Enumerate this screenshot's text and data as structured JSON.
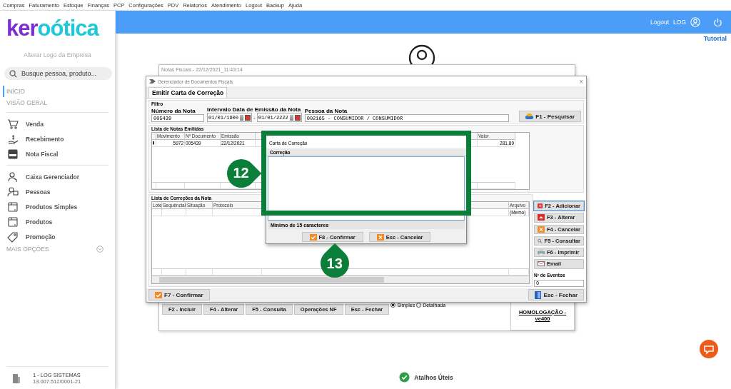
{
  "menu": [
    "Compras",
    "Faturamento",
    "Estoque",
    "Finanças",
    "PCP",
    "Configurações",
    "PDV",
    "Relatorios",
    "Atendimento",
    "Logout",
    "Backup",
    "Ajuda"
  ],
  "sidebar": {
    "logo_prefix": "ker",
    "logo_suffix": "oótica",
    "logo_link": "Alterar Logo da Empresa",
    "search": {
      "placeholder": "Busque pessoa, produto..."
    },
    "sections": [
      {
        "label": "INÍCIO",
        "selected": true
      },
      {
        "label": "VISÃO GERAL",
        "selected": false
      }
    ],
    "groups": [
      [
        {
          "label": "Venda"
        },
        {
          "label": "Recebimento"
        },
        {
          "label": "Nota Fiscal"
        }
      ],
      [
        {
          "label": "Caixa Gerenciador"
        },
        {
          "label": "Pessoas"
        },
        {
          "label": "Produtos Simples"
        },
        {
          "label": "Produtos"
        },
        {
          "label": "Promoção"
        }
      ]
    ],
    "more": "MAIS OPÇÕES",
    "expanded": false,
    "company": {
      "name": "1 - LOG SISTEMAS",
      "cnpj": "13.007.512/0001-21"
    }
  },
  "header": {
    "logout": "Logout",
    "user": "LOG",
    "tutorial": "Tutorial"
  },
  "back_window": {
    "title": "Notas Fiscais - 22/12/2021_11:43:14",
    "buttons": [
      {
        "label": "F2 - Incluir"
      },
      {
        "label": "F4 - Alterar"
      },
      {
        "label": "F5 - Consulta"
      },
      {
        "label": "Operações NF"
      },
      {
        "label": "Esc - Fechar"
      }
    ],
    "radios": [
      {
        "label": "Simples",
        "selected": true
      },
      {
        "label": "Detalhada",
        "selected": false
      }
    ],
    "environment": [
      "HOMOLOGAÇÃO -",
      "ve400"
    ]
  },
  "window": {
    "title": "Gerenciador de Documentos Fiscais",
    "close_symbol": "×",
    "tab": "Emitir Carta de Correção",
    "filter": {
      "legend": "Filtro",
      "number_label": "Número da Nota",
      "number": "005439",
      "range_label": "Intervalo Data de Emissão da Nota",
      "date_from": "01/01/1900",
      "separator": "-",
      "date_to": "01/01/2222",
      "person_label": "Pessoa da Nota",
      "person": "002165 - CONSUMIDOR / CONSUMIDOR",
      "search_button": "F1 - Pesquisar"
    },
    "notes": {
      "legend": "Lista de Notas Emitidas",
      "columns": [
        "Movimento",
        "Nº Documento",
        "Emissão",
        "Valor"
      ],
      "rows": [
        {
          "movimento": "5972",
          "documento": "005439",
          "emissao": "22/12/2021",
          "valor": "281,89"
        }
      ]
    },
    "corrections": {
      "legend": "Lista de Correções da Nota",
      "columns": [
        "Lote",
        "Sequêncial",
        "Situação",
        "Protocolo",
        "Arquivo"
      ],
      "rows": [
        {
          "arquivo": "(Memo)"
        }
      ]
    },
    "side_buttons": [
      {
        "label": "F2 - Adicionar",
        "focused": true
      },
      {
        "label": "F3 - Alterar",
        "focused": false
      },
      {
        "label": "F4 - Cancelar",
        "focused": false
      },
      {
        "label": "F5 - Consultar",
        "focused": false
      },
      {
        "label": "F6 - Imprimir",
        "focused": false
      },
      {
        "label": "Email",
        "focused": false
      }
    ],
    "events": {
      "label": "Nº de Eventos",
      "value": "0"
    },
    "confirm": "F7 - Confirmar",
    "close": "Esc - Fechar"
  },
  "dialog": {
    "title": "Carta de Correção",
    "field_label": "Correção",
    "hint": "Mínimo de 15 caracteres",
    "buttons": [
      {
        "label": "F8 - Confirmar"
      },
      {
        "label": "Esc - Cancelar"
      }
    ]
  },
  "callouts": [
    {
      "number": "12"
    },
    {
      "number": "13"
    }
  ],
  "shortcuts": "Atalhos Úteis"
}
